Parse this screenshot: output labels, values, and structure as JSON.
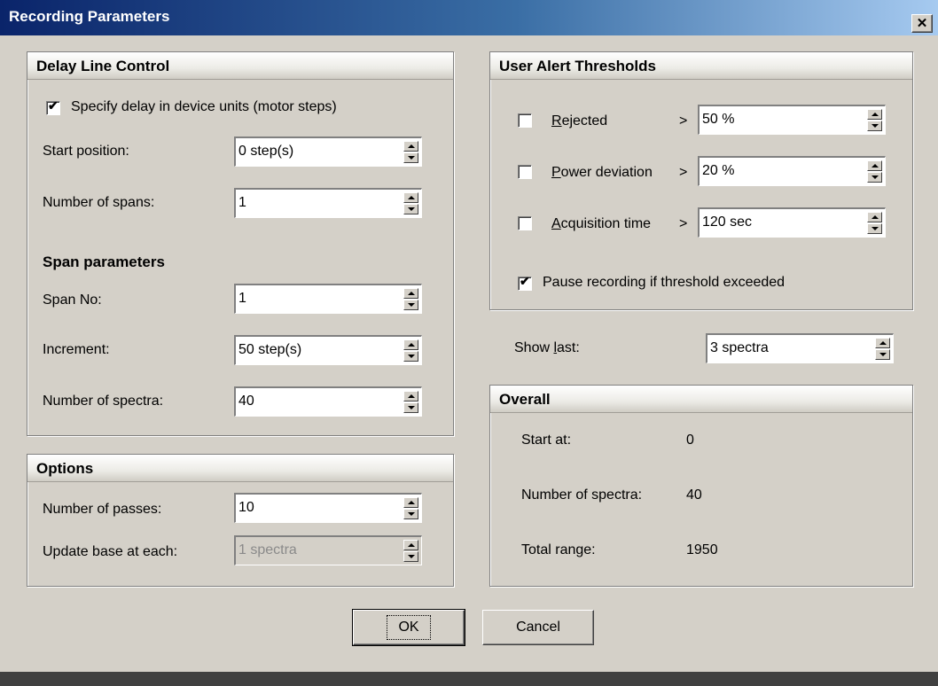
{
  "window": {
    "title": "Recording Parameters",
    "close_glyph": "✕"
  },
  "delay": {
    "title": "Delay Line Control",
    "device_units": {
      "label": "Specify delay in device units (motor steps)",
      "checked": true
    },
    "start_position": {
      "label": "Start position:",
      "value": "0 step(s)"
    },
    "num_spans": {
      "label": "Number of spans:",
      "value": "1"
    },
    "span_params_heading": "Span parameters",
    "span_no": {
      "label": "Span No:",
      "value": "1"
    },
    "increment": {
      "label": "Increment:",
      "value": "50 step(s)"
    },
    "num_spectra": {
      "label": "Number of spectra:",
      "value": "40"
    }
  },
  "options": {
    "title": "Options",
    "passes": {
      "label": "Number of passes:",
      "value": "10"
    },
    "update_base": {
      "label": "Update base at each:",
      "value": "1 spectra",
      "disabled": true
    }
  },
  "alerts": {
    "title": "User Alert Thresholds",
    "rejected": {
      "label": "Rejected",
      "gt": ">",
      "value": "50 %",
      "checked": false
    },
    "power": {
      "label": "Power deviation",
      "gt": ">",
      "value": "20 %",
      "checked": false
    },
    "acq": {
      "label": "Acquisition time",
      "gt": ">",
      "value": "120 sec",
      "checked": false
    },
    "pause": {
      "label": "Pause recording if threshold exceeded",
      "checked": true
    }
  },
  "show_last": {
    "label": "Show last:",
    "value": "3 spectra"
  },
  "overall": {
    "title": "Overall",
    "start_at": {
      "label": "Start at:",
      "value": "0"
    },
    "num_spectra": {
      "label": "Number of spectra:",
      "value": "40"
    },
    "total_range": {
      "label": "Total range:",
      "value": "1950"
    }
  },
  "buttons": {
    "ok": "OK",
    "cancel": "Cancel"
  },
  "glyphs": {
    "check": "✔"
  }
}
